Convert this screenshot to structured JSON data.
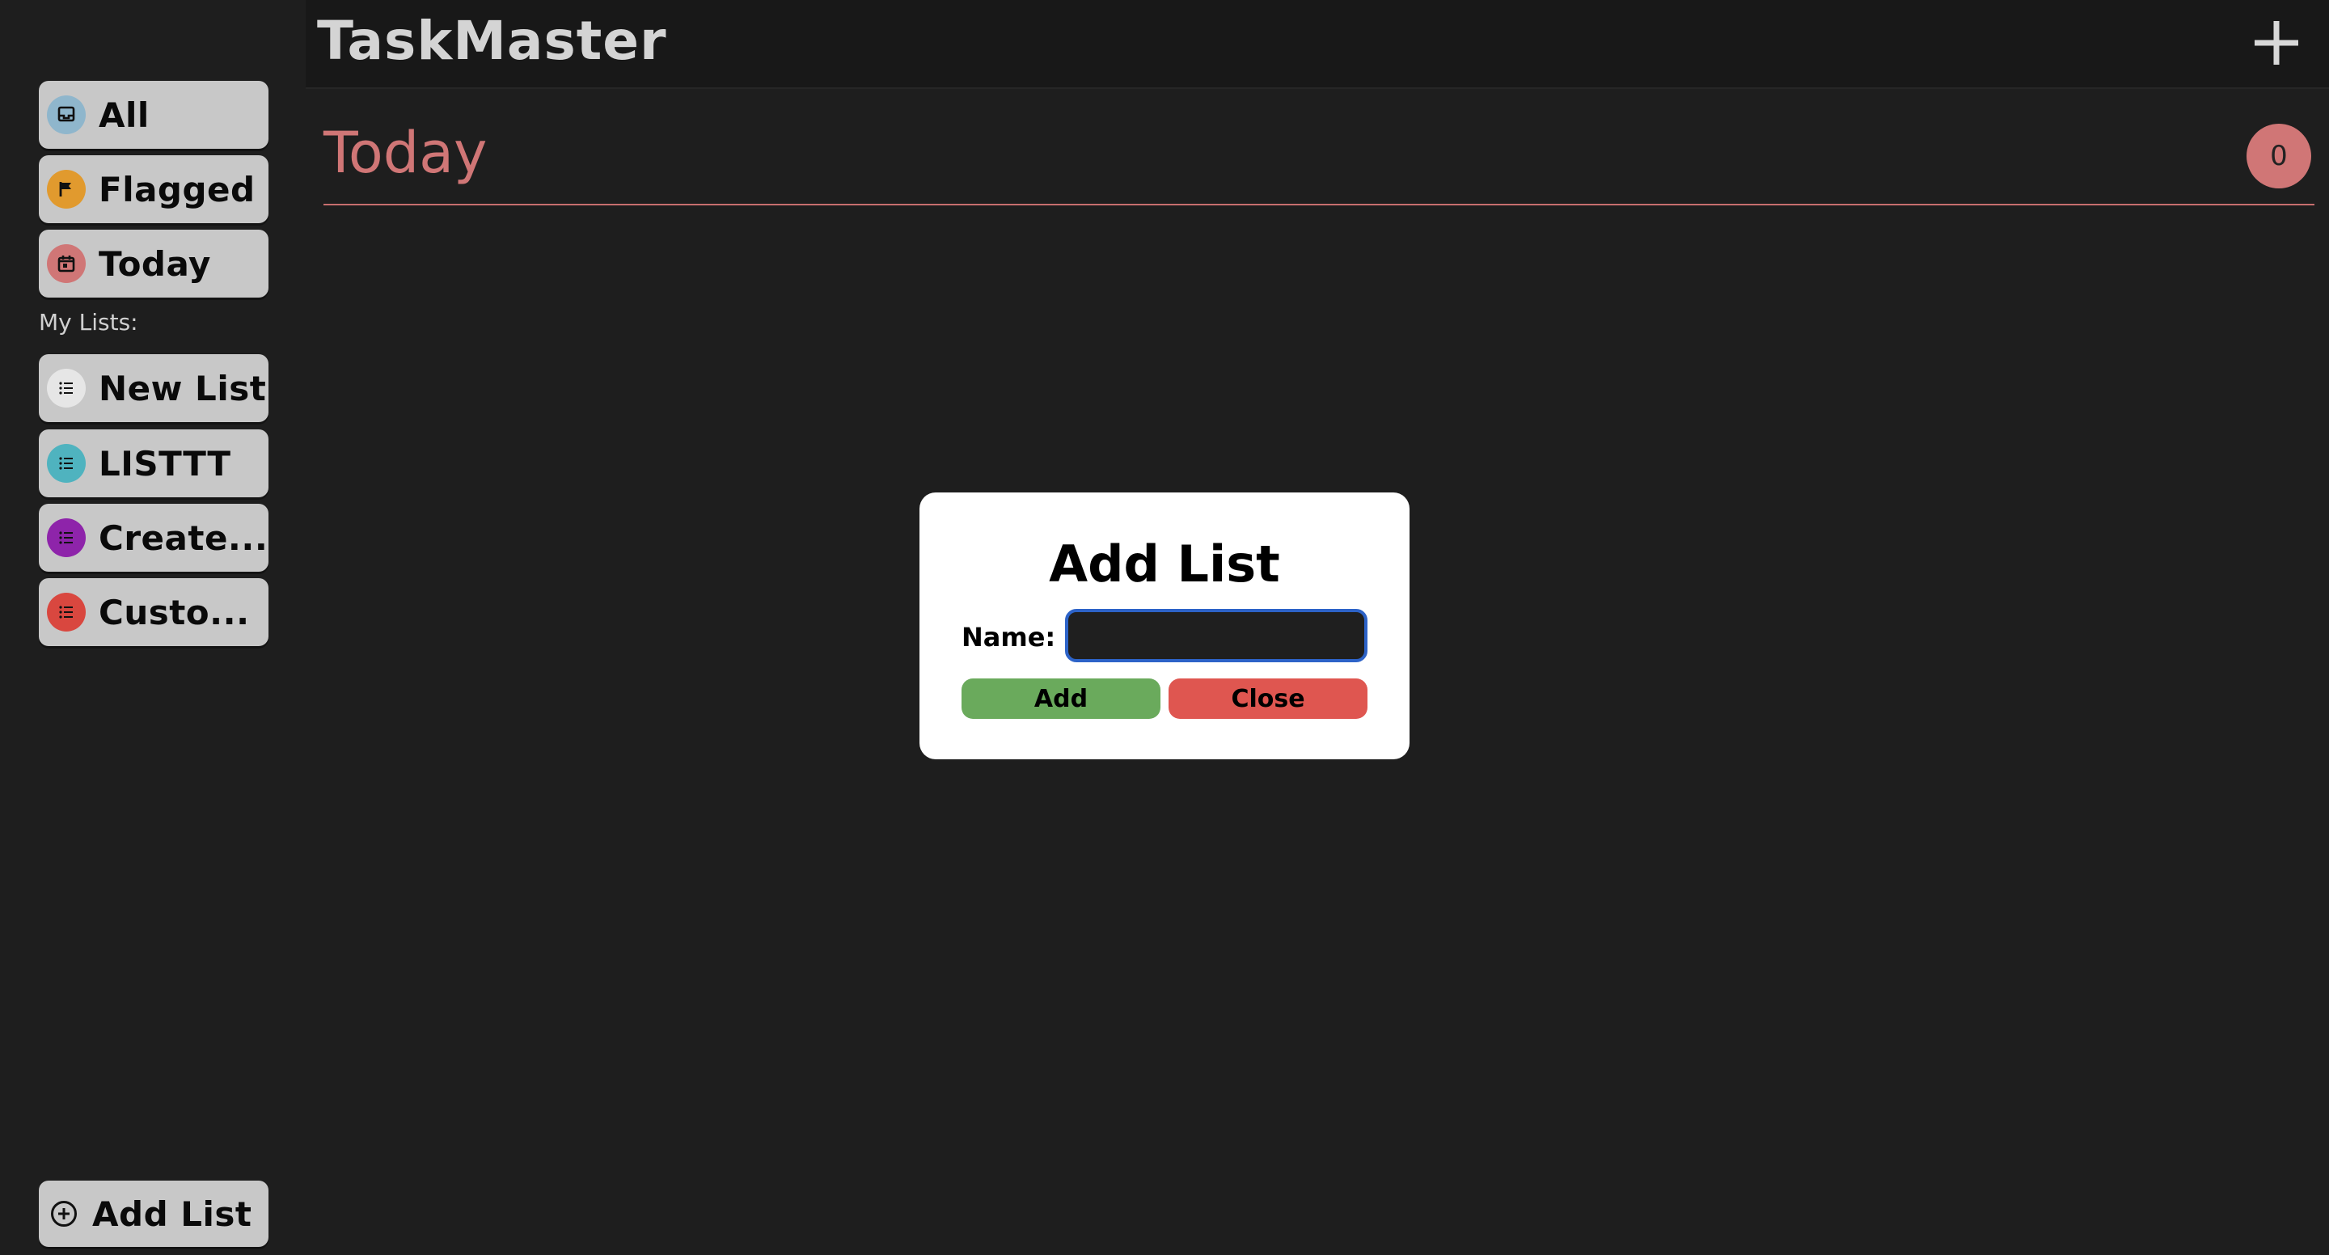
{
  "app": {
    "title": "TaskMaster"
  },
  "sidebar": {
    "smart_lists": [
      {
        "label": "All",
        "icon": "inbox-icon",
        "color": "#8fb6cc"
      },
      {
        "label": "Flagged",
        "icon": "flag-icon",
        "color": "#e19a2e"
      },
      {
        "label": "Today",
        "icon": "calendar-icon",
        "color": "#d07676"
      }
    ],
    "my_lists_label": "My Lists:",
    "lists": [
      {
        "label": "New List",
        "icon": "list-icon",
        "color": "#e6e6e6"
      },
      {
        "label": "LISTTT",
        "icon": "list-icon",
        "color": "#4fb3bf"
      },
      {
        "label": "Create...",
        "icon": "list-icon",
        "color": "#8e24aa"
      },
      {
        "label": "Custo...",
        "icon": "list-icon",
        "color": "#d9473f"
      }
    ],
    "add_list_label": "Add List"
  },
  "view": {
    "title": "Today",
    "count": "0",
    "accent": "#d07676"
  },
  "modal": {
    "title": "Add List",
    "name_label": "Name:",
    "name_value": "",
    "add_label": "Add",
    "close_label": "Close"
  }
}
